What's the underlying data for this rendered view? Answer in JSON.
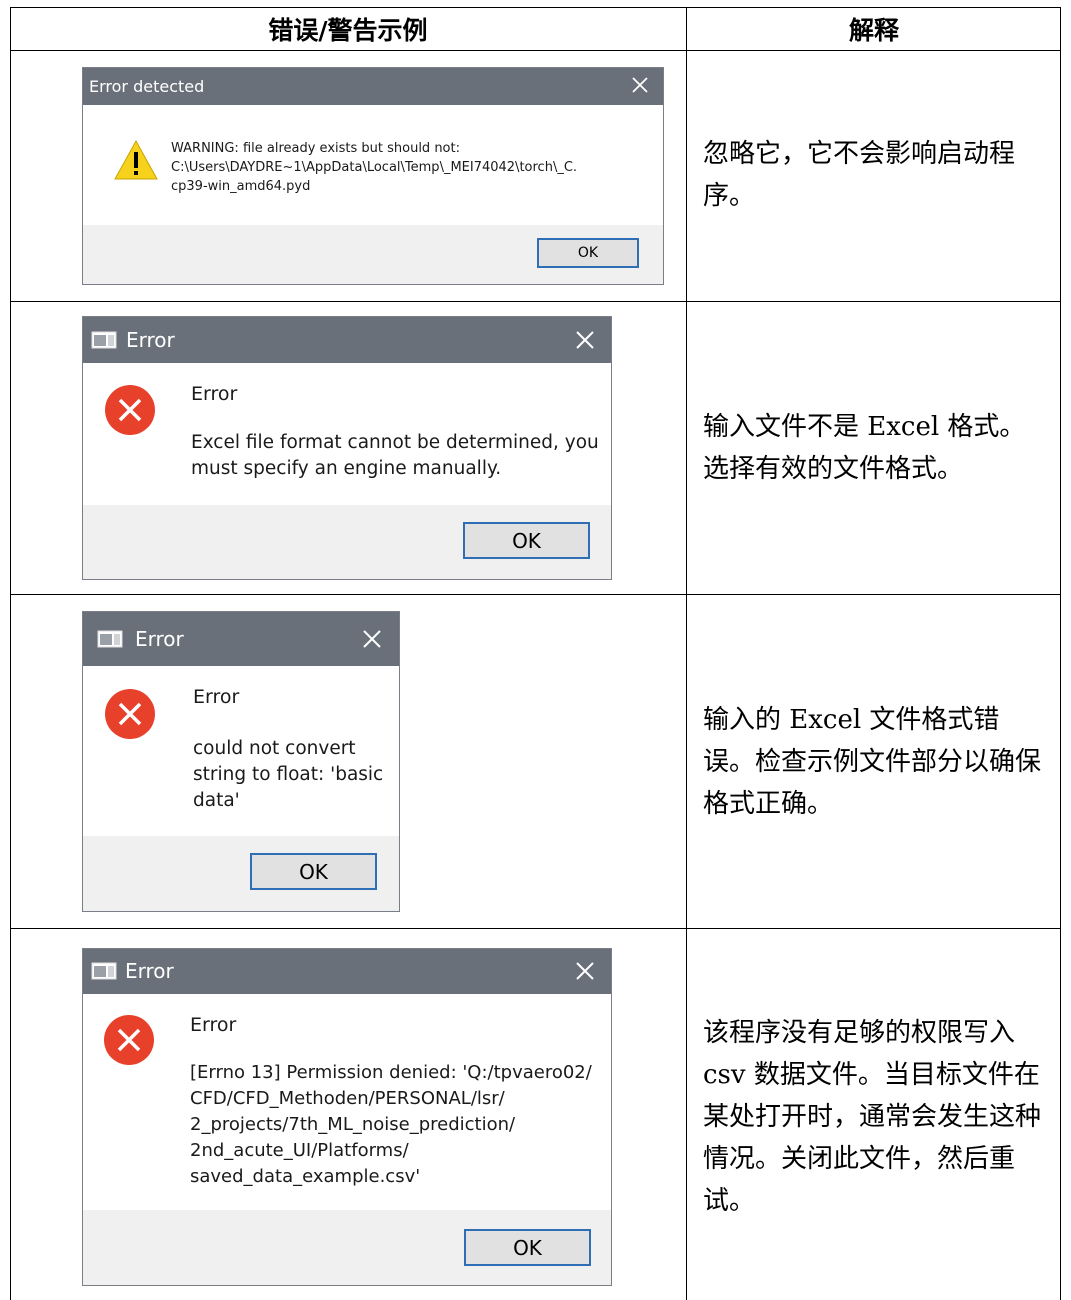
{
  "table": {
    "header_example": "错误/警告示例",
    "header_explain": "解释"
  },
  "rows": [
    {
      "dialog": {
        "title": "Error detected",
        "message": "WARNING: file already exists but should not:\nC:\\Users\\DAYDRE~1\\AppData\\Local\\Temp\\_MEI74042\\torch\\_C.\ncp39-win_amd64.pyd",
        "ok_label": "OK"
      },
      "explain": "忽略它，它不会影响启动程序。"
    },
    {
      "dialog": {
        "title": "Error",
        "heading": "Error",
        "message": "Excel file format cannot be determined, you\nmust specify an engine manually.",
        "ok_label": "OK"
      },
      "explain": "输入文件不是 Excel  格式。选择有效的文件格式。"
    },
    {
      "dialog": {
        "title": "Error",
        "heading": "Error",
        "message": "could not convert\nstring to float: 'basic\ndata'",
        "ok_label": "OK"
      },
      "explain": "输入的 Excel  文件格式错误。检查示例文件部分以确保格式正确。"
    },
    {
      "dialog": {
        "title": "Error",
        "heading": "Error",
        "message": "[Errno 13] Permission denied: 'Q:/tpvaero02/\nCFD/CFD_Methoden/PERSONAL/lsr/\n2_projects/7th_ML_noise_prediction/\n2nd_acute_UI/Platforms/\nsaved_data_example.csv'",
        "ok_label": "OK"
      },
      "explain": "该程序没有足够的权限写入 csv  数据文件。当目标文件在某处打开时，通常会发生这种情况。关闭此文件，然后重试。"
    }
  ],
  "icons": {
    "warning": "warning-icon",
    "error": "error-icon",
    "close": "close-icon",
    "app": "app-window-icon"
  },
  "colors": {
    "titlebar": "#69707a",
    "error_red": "#e8412b",
    "warning_yellow": "#f7d21c",
    "ok_border": "#2f6db5"
  }
}
